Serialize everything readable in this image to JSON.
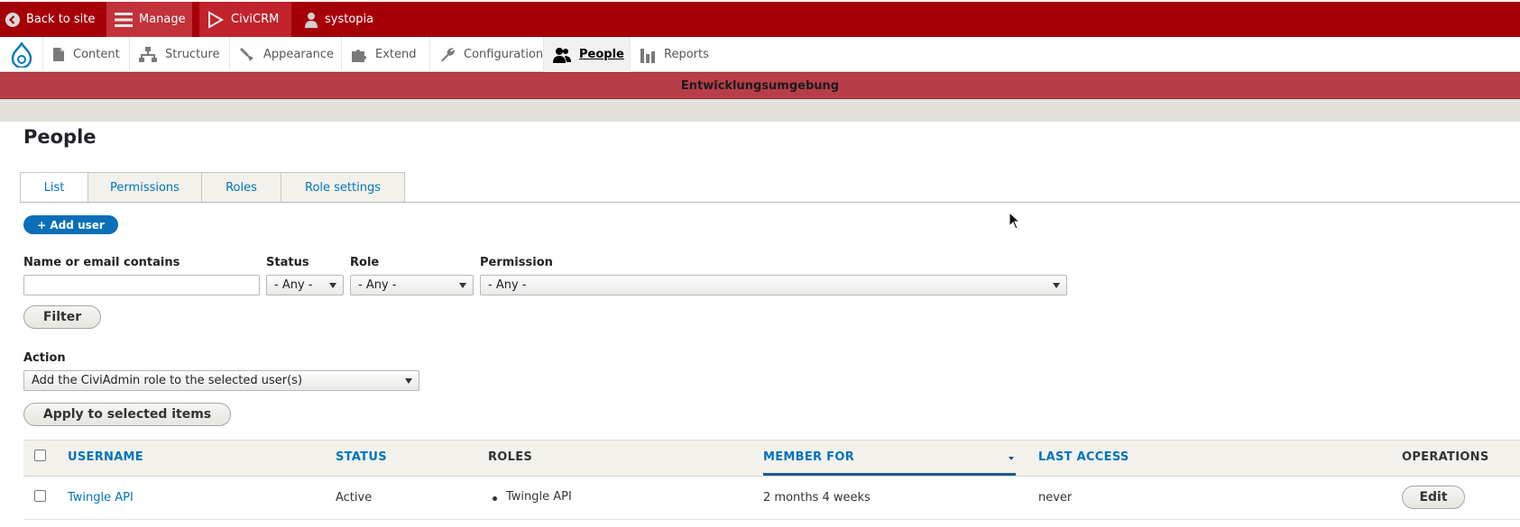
{
  "toolbar": {
    "back_label": "Back to site",
    "manage_label": "Manage",
    "civicrm_label": "CiviCRM",
    "user_label": "systopia"
  },
  "tray": {
    "items": [
      {
        "label": "Content",
        "icon": "file-icon"
      },
      {
        "label": "Structure",
        "icon": "sitemap-icon"
      },
      {
        "label": "Appearance",
        "icon": "paintbrush-icon"
      },
      {
        "label": "Extend",
        "icon": "puzzle-icon"
      },
      {
        "label": "Configuration",
        "icon": "wrench-icon"
      },
      {
        "label": "People",
        "icon": "people-icon",
        "active": true
      },
      {
        "label": "Reports",
        "icon": "bar-chart-icon"
      }
    ]
  },
  "environment_label": "Entwicklungsumgebung",
  "page": {
    "title": "People",
    "tabs": [
      {
        "label": "List",
        "active": true
      },
      {
        "label": "Permissions"
      },
      {
        "label": "Roles"
      },
      {
        "label": "Role settings"
      }
    ],
    "add_user_label": "+ Add user"
  },
  "filters": {
    "name_label": "Name or email contains",
    "name_value": "",
    "status_label": "Status",
    "status_value": "- Any -",
    "role_label": "Role",
    "role_value": "- Any -",
    "permission_label": "Permission",
    "permission_value": "- Any -",
    "filter_button": "Filter"
  },
  "bulk": {
    "action_label": "Action",
    "action_value": "Add the CiviAdmin role to the selected user(s)",
    "apply_button": "Apply to selected items"
  },
  "table": {
    "headers": {
      "username": "USERNAME",
      "status": "STATUS",
      "roles": "ROLES",
      "member_for": "MEMBER FOR",
      "last_access": "LAST ACCESS",
      "operations": "OPERATIONS"
    },
    "rows": [
      {
        "username": "Twingle API",
        "status": "Active",
        "role": "Twingle API",
        "member_for": "2 months 4 weeks",
        "last_access": "never",
        "operation": "Edit"
      }
    ]
  },
  "colors": {
    "toolbar_red": "#a50008",
    "environment_bar": "#b73e49",
    "link_blue": "#0074bd",
    "primary_button": "#0b6fb8"
  }
}
